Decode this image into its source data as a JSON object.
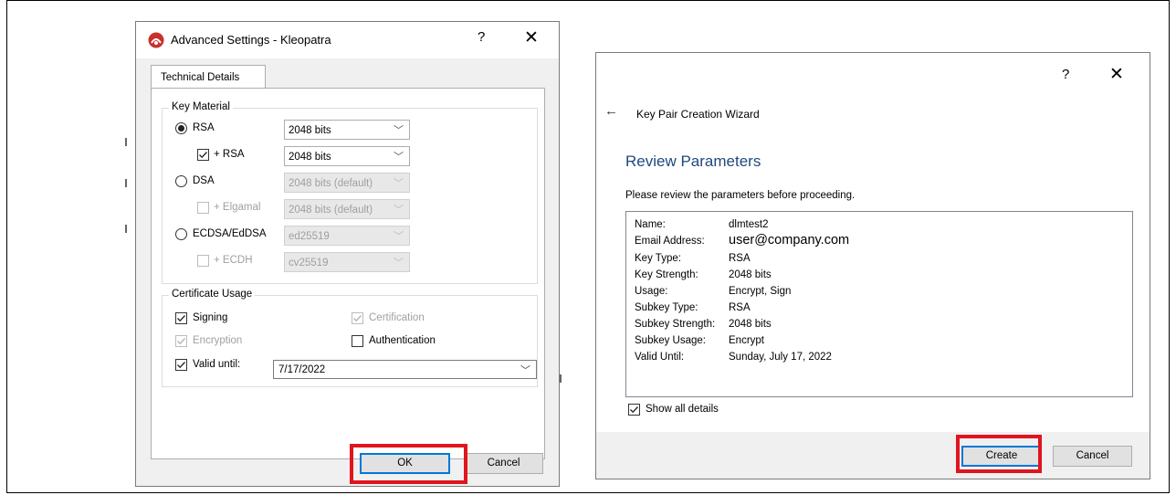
{
  "advanced_dialog": {
    "title": "Advanced Settings - Kleopatra",
    "help_glyph": "?",
    "close_glyph": "✕",
    "tab": "Technical Details",
    "key_material": {
      "group_title": "Key Material",
      "rows": [
        {
          "type": "radio",
          "label": "RSA",
          "checked": true,
          "enabled": true,
          "combo": "2048 bits"
        },
        {
          "type": "checkbox",
          "label": "+ RSA",
          "checked": true,
          "enabled": true,
          "combo": "2048 bits"
        },
        {
          "type": "radio",
          "label": "DSA",
          "checked": false,
          "enabled": true,
          "combo": "2048 bits (default)"
        },
        {
          "type": "checkbox",
          "label": "+ Elgamal",
          "checked": false,
          "enabled": false,
          "combo": "2048 bits (default)"
        },
        {
          "type": "radio",
          "label": "ECDSA/EdDSA",
          "checked": false,
          "enabled": true,
          "combo": "ed25519"
        },
        {
          "type": "checkbox",
          "label": "+ ECDH",
          "checked": false,
          "enabled": false,
          "combo": "cv25519"
        }
      ]
    },
    "certificate_usage": {
      "group_title": "Certificate Usage",
      "signing": "Signing",
      "certification": "Certification",
      "encryption": "Encryption",
      "authentication": "Authentication",
      "valid_until_label": "Valid until:",
      "valid_until_value": "7/17/2022"
    },
    "ok_label": "OK",
    "cancel_label": "Cancel"
  },
  "wizard_dialog": {
    "help_glyph": "?",
    "close_glyph": "✕",
    "back_glyph": "←",
    "title": "Key Pair Creation Wizard",
    "heading": "Review Parameters",
    "intro": "Please review the parameters before proceeding.",
    "parameters": [
      {
        "key": "Name:",
        "value": "dlmtest2"
      },
      {
        "key": "Email Address:",
        "value": "user@company.com"
      },
      {
        "key": "Key Type:",
        "value": "RSA"
      },
      {
        "key": "Key Strength:",
        "value": "2048 bits"
      },
      {
        "key": "Usage:",
        "value": "Encrypt, Sign"
      },
      {
        "key": "Subkey Type:",
        "value": "RSA"
      },
      {
        "key": "Subkey Strength:",
        "value": "2048 bits"
      },
      {
        "key": "Subkey Usage:",
        "value": "Encrypt"
      },
      {
        "key": "Valid Until:",
        "value": "Sunday, July 17, 2022"
      }
    ],
    "show_details_label": "Show all details",
    "create_label": "Create",
    "cancel_label": "Cancel"
  },
  "colors": {
    "highlight": "#e0151e",
    "heading": "#1f497d",
    "default_button": "#0078d7"
  }
}
